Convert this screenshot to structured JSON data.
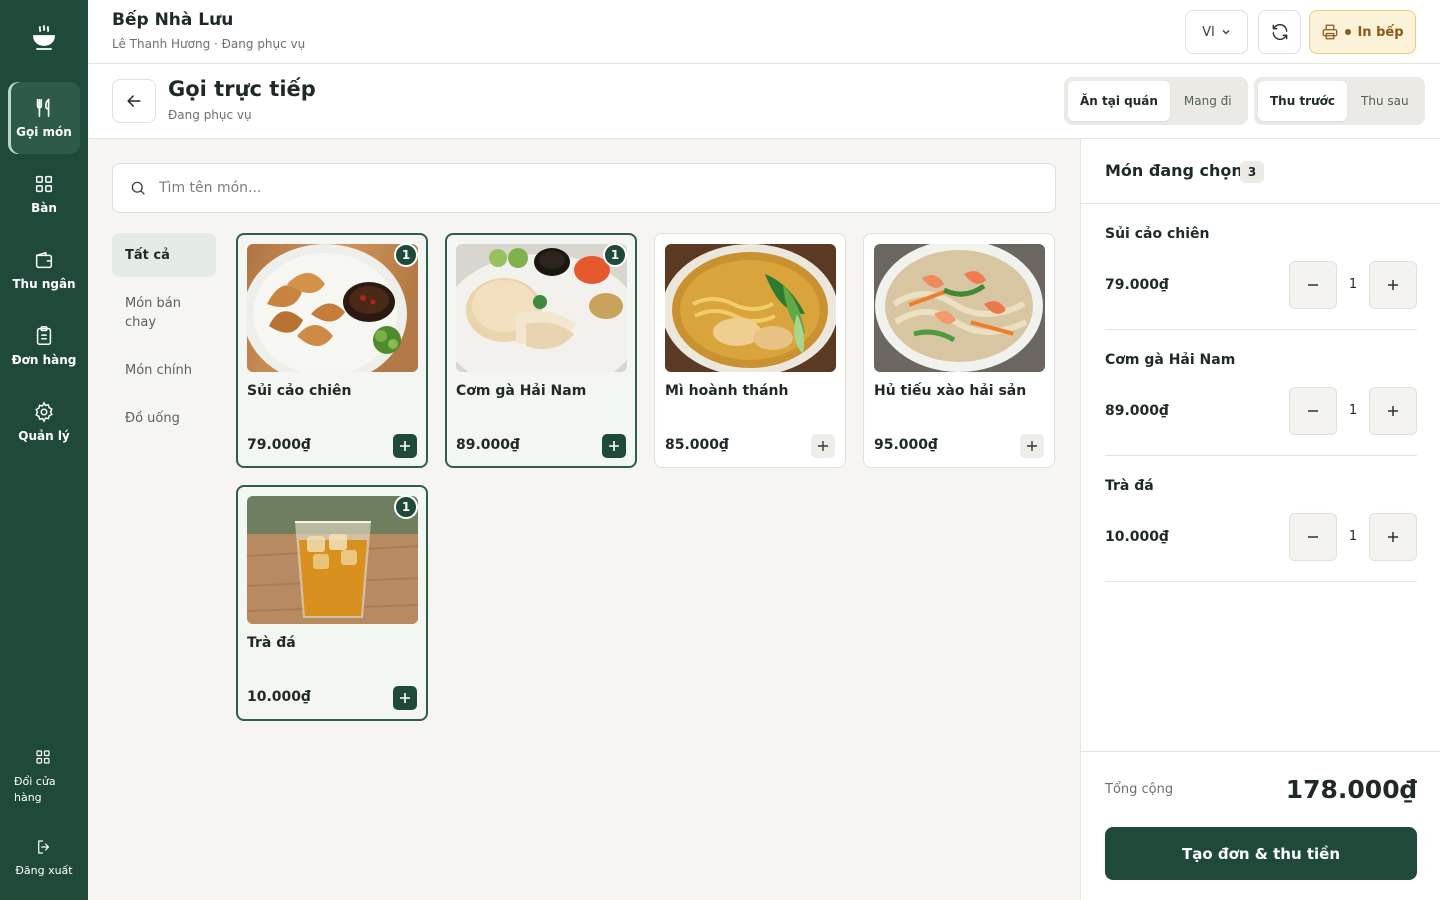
{
  "colors": {
    "primary": "#1f4a39",
    "accent_warm": "#fcf2da",
    "background": "#f6f5f1"
  },
  "sidebar": {
    "logo_icon": "bowl-steam-icon",
    "items": [
      {
        "label": "Gọi món",
        "icon": "utensils-icon",
        "active": true
      },
      {
        "label": "Bàn",
        "icon": "grid-icon",
        "active": false
      },
      {
        "label": "Thu ngân",
        "icon": "wallet-icon",
        "active": false
      },
      {
        "label": "Đơn hàng",
        "icon": "clipboard-icon",
        "active": false
      },
      {
        "label": "Quản lý",
        "icon": "gear-icon",
        "active": false
      }
    ],
    "switch_store_label_1": "Đổi cửa",
    "switch_store_label_2": "hàng",
    "logout_label": "Đăng xuất"
  },
  "header": {
    "store_name": "Bếp Nhà Lưu",
    "store_subtitle": "Lê Thanh Hương · Đang phục vụ",
    "language": "VI",
    "kitchen_print_label": "In bếp"
  },
  "subheader": {
    "title": "Gọi trực tiếp",
    "subtitle": "Đang phục vụ",
    "dining_modes": [
      {
        "label": "Ăn tại quán",
        "selected": true
      },
      {
        "label": "Mang đi",
        "selected": false
      }
    ],
    "payment_modes": [
      {
        "label": "Thu trước",
        "selected": true
      },
      {
        "label": "Thu sau",
        "selected": false
      }
    ]
  },
  "search": {
    "placeholder": "Tìm tên món...",
    "value": ""
  },
  "categories": [
    {
      "label": "Tất cả",
      "active": true
    },
    {
      "label": "Món bán chay",
      "active": false
    },
    {
      "label": "Món chính",
      "active": false
    },
    {
      "label": "Đồ uống",
      "active": false
    }
  ],
  "menu": [
    {
      "name": "Sủi cảo chiên",
      "price": "79.000₫",
      "qty": "1",
      "selected": true,
      "image": "fried-dumplings-photo"
    },
    {
      "name": "Cơm gà Hải Nam",
      "price": "89.000₫",
      "qty": "1",
      "selected": true,
      "image": "hainanese-chicken-rice-photo"
    },
    {
      "name": "Mì hoành thánh",
      "price": "85.000₫",
      "qty": "",
      "selected": false,
      "image": "wonton-noodle-soup-photo"
    },
    {
      "name": "Hủ tiếu xào hải sản",
      "price": "95.000₫",
      "qty": "",
      "selected": false,
      "image": "seafood-stir-fried-noodles-photo"
    },
    {
      "name": "Trà đá",
      "price": "10.000₫",
      "qty": "1",
      "selected": true,
      "image": "iced-tea-photo"
    }
  ],
  "order": {
    "title": "Món đang chọn",
    "count": "3",
    "lines": [
      {
        "name": "Sủi cảo chiên",
        "price": "79.000₫",
        "qty": "1"
      },
      {
        "name": "Cơm gà Hải Nam",
        "price": "89.000₫",
        "qty": "1"
      },
      {
        "name": "Trà đá",
        "price": "10.000₫",
        "qty": "1"
      }
    ],
    "total_label": "Tổng cộng",
    "total_value": "178.000₫",
    "submit_label": "Tạo đơn & thu tiền"
  }
}
